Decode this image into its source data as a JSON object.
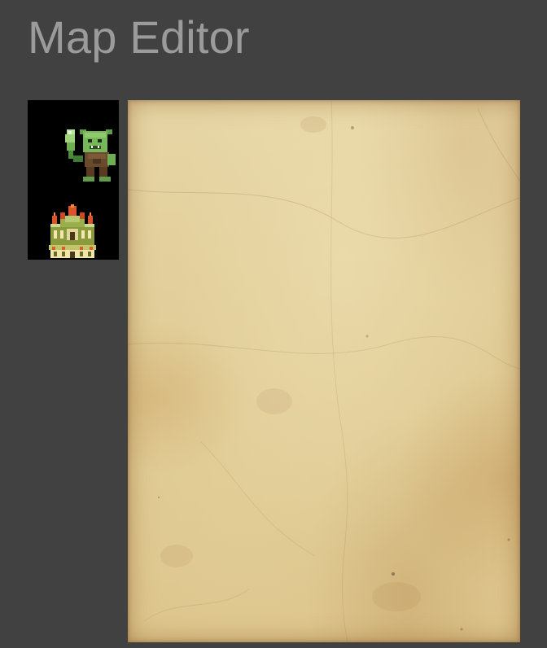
{
  "page": {
    "title": "Map Editor"
  },
  "palette": {
    "tiles": [
      {
        "name": "goblin-tile",
        "icon": "goblin-sprite"
      },
      {
        "name": "castle-tile",
        "icon": "castle-sprite"
      }
    ]
  },
  "map": {
    "background": "parchment"
  },
  "colors": {
    "page_background": "#414141",
    "title_text": "#9b9b9b",
    "palette_background": "#000000",
    "parchment": "#e1cd98"
  }
}
